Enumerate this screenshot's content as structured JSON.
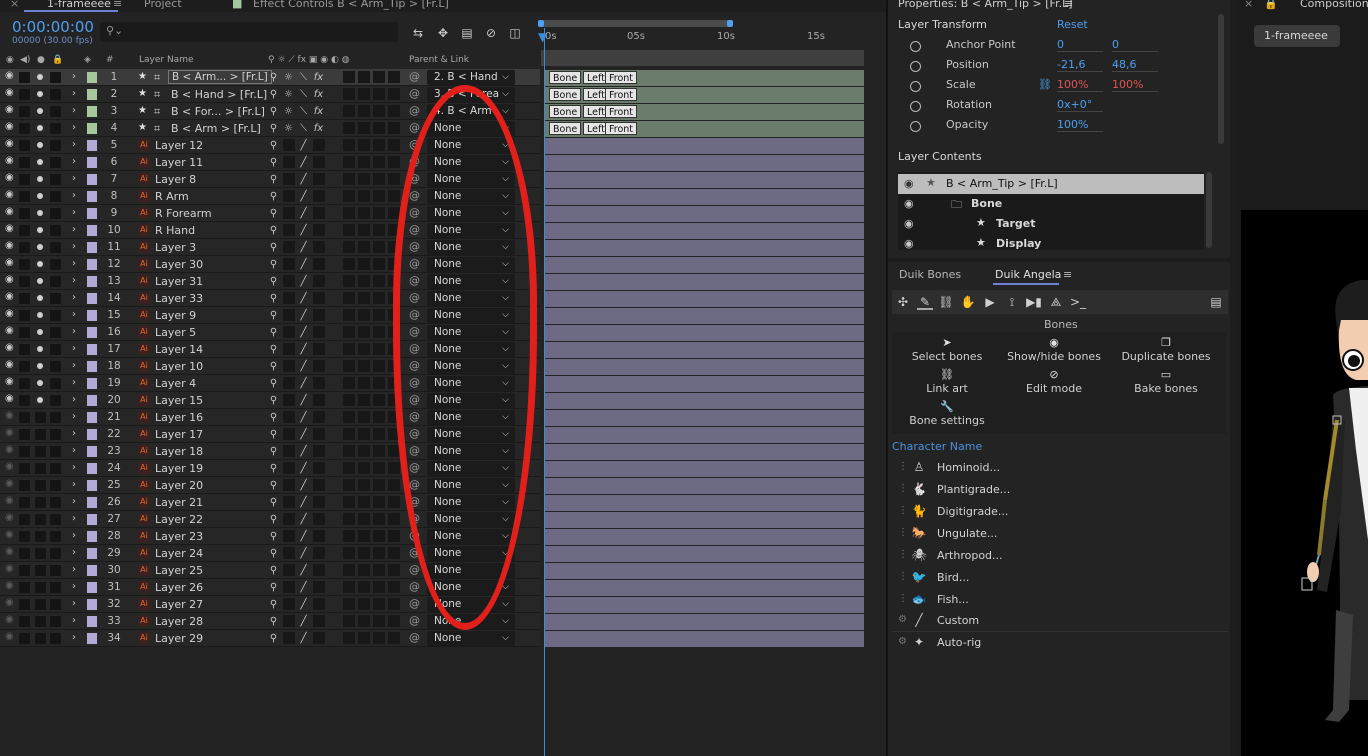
{
  "timeline": {
    "tabs": [
      "1-frameeee",
      "Project",
      "Effect Controls B < Arm_Tip > [Fr.L]"
    ],
    "timecode": "0:00:00:00",
    "fps": "00000 (30.00 fps)",
    "search_placeholder": "",
    "header": {
      "hash": "#",
      "layer_name": "Layer Name",
      "parent_link": "Parent & Link"
    },
    "ruler": [
      "0s",
      "05s",
      "10s",
      "15s"
    ],
    "layers": [
      {
        "num": "1",
        "name": "B < Arm... > [Fr.L]",
        "type": "star",
        "label": "#a7c79c",
        "parent": "2. B < Hand",
        "selected": true,
        "bone": true,
        "vis": true
      },
      {
        "num": "2",
        "name": "B < Hand > [Fr.L]",
        "type": "star",
        "label": "#a7c79c",
        "parent": "3. B < Forea",
        "bone": true,
        "vis": true
      },
      {
        "num": "3",
        "name": "B < For... > [Fr.L]",
        "type": "star",
        "label": "#a7c79c",
        "parent": "4. B < Arm",
        "bone": true,
        "vis": true
      },
      {
        "num": "4",
        "name": "B < Arm > [Fr.L]",
        "type": "star",
        "label": "#a7c79c",
        "parent": "None",
        "bone": true,
        "vis": true
      },
      {
        "num": "5",
        "name": "Layer 12",
        "type": "ai",
        "label": "#b3a9d6",
        "parent": "None",
        "vis": true
      },
      {
        "num": "6",
        "name": "Layer 11",
        "type": "ai",
        "label": "#b3a9d6",
        "parent": "None",
        "vis": true
      },
      {
        "num": "7",
        "name": "Layer 8",
        "type": "ai",
        "label": "#b3a9d6",
        "parent": "None",
        "vis": true
      },
      {
        "num": "8",
        "name": "R Arm",
        "type": "ai",
        "label": "#b3a9d6",
        "parent": "None",
        "vis": true
      },
      {
        "num": "9",
        "name": "R Forearm",
        "type": "ai",
        "label": "#b3a9d6",
        "parent": "None",
        "vis": true
      },
      {
        "num": "10",
        "name": "R Hand",
        "type": "ai",
        "label": "#b3a9d6",
        "parent": "None",
        "vis": true
      },
      {
        "num": "11",
        "name": "Layer 3",
        "type": "ai",
        "label": "#b3a9d6",
        "parent": "None",
        "vis": true
      },
      {
        "num": "12",
        "name": "Layer 30",
        "type": "ai",
        "label": "#b3a9d6",
        "parent": "None",
        "vis": true
      },
      {
        "num": "13",
        "name": "Layer 31",
        "type": "ai",
        "label": "#b3a9d6",
        "parent": "None",
        "vis": true
      },
      {
        "num": "14",
        "name": "Layer 33",
        "type": "ai",
        "label": "#b3a9d6",
        "parent": "None",
        "vis": true
      },
      {
        "num": "15",
        "name": "Layer 9",
        "type": "ai",
        "label": "#b3a9d6",
        "parent": "None",
        "vis": true
      },
      {
        "num": "16",
        "name": "Layer 5",
        "type": "ai",
        "label": "#b3a9d6",
        "parent": "None",
        "vis": true
      },
      {
        "num": "17",
        "name": "Layer 14",
        "type": "ai",
        "label": "#b3a9d6",
        "parent": "None",
        "vis": true
      },
      {
        "num": "18",
        "name": "Layer 10",
        "type": "ai",
        "label": "#b3a9d6",
        "parent": "None",
        "vis": true
      },
      {
        "num": "19",
        "name": "Layer 4",
        "type": "ai",
        "label": "#b3a9d6",
        "parent": "None",
        "vis": true
      },
      {
        "num": "20",
        "name": "Layer 15",
        "type": "ai",
        "label": "#b3a9d6",
        "parent": "None",
        "vis": true
      },
      {
        "num": "21",
        "name": "Layer 16",
        "type": "ai",
        "label": "#b3a9d6",
        "parent": "None",
        "vis": false
      },
      {
        "num": "22",
        "name": "Layer 17",
        "type": "ai",
        "label": "#b3a9d6",
        "parent": "None",
        "vis": false
      },
      {
        "num": "23",
        "name": "Layer 18",
        "type": "ai",
        "label": "#b3a9d6",
        "parent": "None",
        "vis": false
      },
      {
        "num": "24",
        "name": "Layer 19",
        "type": "ai",
        "label": "#b3a9d6",
        "parent": "None",
        "vis": false
      },
      {
        "num": "25",
        "name": "Layer 20",
        "type": "ai",
        "label": "#b3a9d6",
        "parent": "None",
        "vis": false
      },
      {
        "num": "26",
        "name": "Layer 21",
        "type": "ai",
        "label": "#b3a9d6",
        "parent": "None",
        "vis": false
      },
      {
        "num": "27",
        "name": "Layer 22",
        "type": "ai",
        "label": "#b3a9d6",
        "parent": "None",
        "vis": false
      },
      {
        "num": "28",
        "name": "Layer 23",
        "type": "ai",
        "label": "#b3a9d6",
        "parent": "None",
        "vis": false
      },
      {
        "num": "29",
        "name": "Layer 24",
        "type": "ai",
        "label": "#b3a9d6",
        "parent": "None",
        "vis": false
      },
      {
        "num": "30",
        "name": "Layer 25",
        "type": "ai",
        "label": "#b3a9d6",
        "parent": "None",
        "vis": false
      },
      {
        "num": "31",
        "name": "Layer 26",
        "type": "ai",
        "label": "#b3a9d6",
        "parent": "None",
        "vis": false
      },
      {
        "num": "32",
        "name": "Layer 27",
        "type": "ai",
        "label": "#b3a9d6",
        "parent": "None",
        "vis": false
      },
      {
        "num": "33",
        "name": "Layer 28",
        "type": "ai",
        "label": "#b3a9d6",
        "parent": "None",
        "vis": false
      },
      {
        "num": "34",
        "name": "Layer 29",
        "type": "ai",
        "label": "#b3a9d6",
        "parent": "None",
        "vis": false
      }
    ],
    "markers": [
      "Bone",
      "Left",
      "Front"
    ]
  },
  "properties": {
    "title": "Properties: B < Arm_Tip > [Fr.L]",
    "section": "Layer Transform",
    "reset": "Reset",
    "rows": [
      {
        "label": "Anchor Point",
        "v1": "0",
        "v2": "0",
        "v2red": false
      },
      {
        "label": "Position",
        "v1": "-21,6",
        "v2": "48,6",
        "v2red": false
      },
      {
        "label": "Scale",
        "v1": "100",
        "v2": "100",
        "unit": "%",
        "v2red": true
      },
      {
        "label": "Rotation",
        "v1": "0x+0°",
        "v2": ""
      },
      {
        "label": "Opacity",
        "v1": "100",
        "v2": "",
        "unit": "%"
      }
    ],
    "contents_title": "Layer Contents",
    "contents": [
      {
        "name": "B < Arm_Tip > [Fr.L]",
        "icon": "star",
        "indent": 0,
        "selected": true
      },
      {
        "name": "Bone",
        "icon": "folder",
        "indent": 1
      },
      {
        "name": "Target",
        "icon": "star",
        "indent": 2
      },
      {
        "name": "Display",
        "icon": "star",
        "indent": 2
      }
    ]
  },
  "duik": {
    "tabs": [
      "Duik Bones",
      "Duik Angela"
    ],
    "bones_title": "Bones",
    "buttons": [
      {
        "label": "Select bones",
        "icon": "➤"
      },
      {
        "label": "Show/hide bones",
        "icon": "◉"
      },
      {
        "label": "Duplicate bones",
        "icon": "❐"
      },
      {
        "label": "Link art",
        "icon": "⛓"
      },
      {
        "label": "Edit mode",
        "icon": "⊘"
      },
      {
        "label": "Bake bones",
        "icon": "▭"
      },
      {
        "label": "Bone settings",
        "icon": "🔧"
      }
    ],
    "character_label": "Character Name",
    "characters": [
      {
        "label": "Hominoid...",
        "icon": "♙"
      },
      {
        "label": "Plantigrade...",
        "icon": "🐇"
      },
      {
        "label": "Digitigrade...",
        "icon": "🐈"
      },
      {
        "label": "Ungulate...",
        "icon": "🐎"
      },
      {
        "label": "Arthropod...",
        "icon": "🕷"
      },
      {
        "label": "Bird...",
        "icon": "🐦"
      },
      {
        "label": "Fish...",
        "icon": "🐟"
      },
      {
        "label": "Custom",
        "icon": "╱"
      },
      {
        "label": "Auto-rig",
        "icon": "✦"
      }
    ]
  },
  "composition": {
    "title": "Composition",
    "tab": "1-frameeee"
  }
}
